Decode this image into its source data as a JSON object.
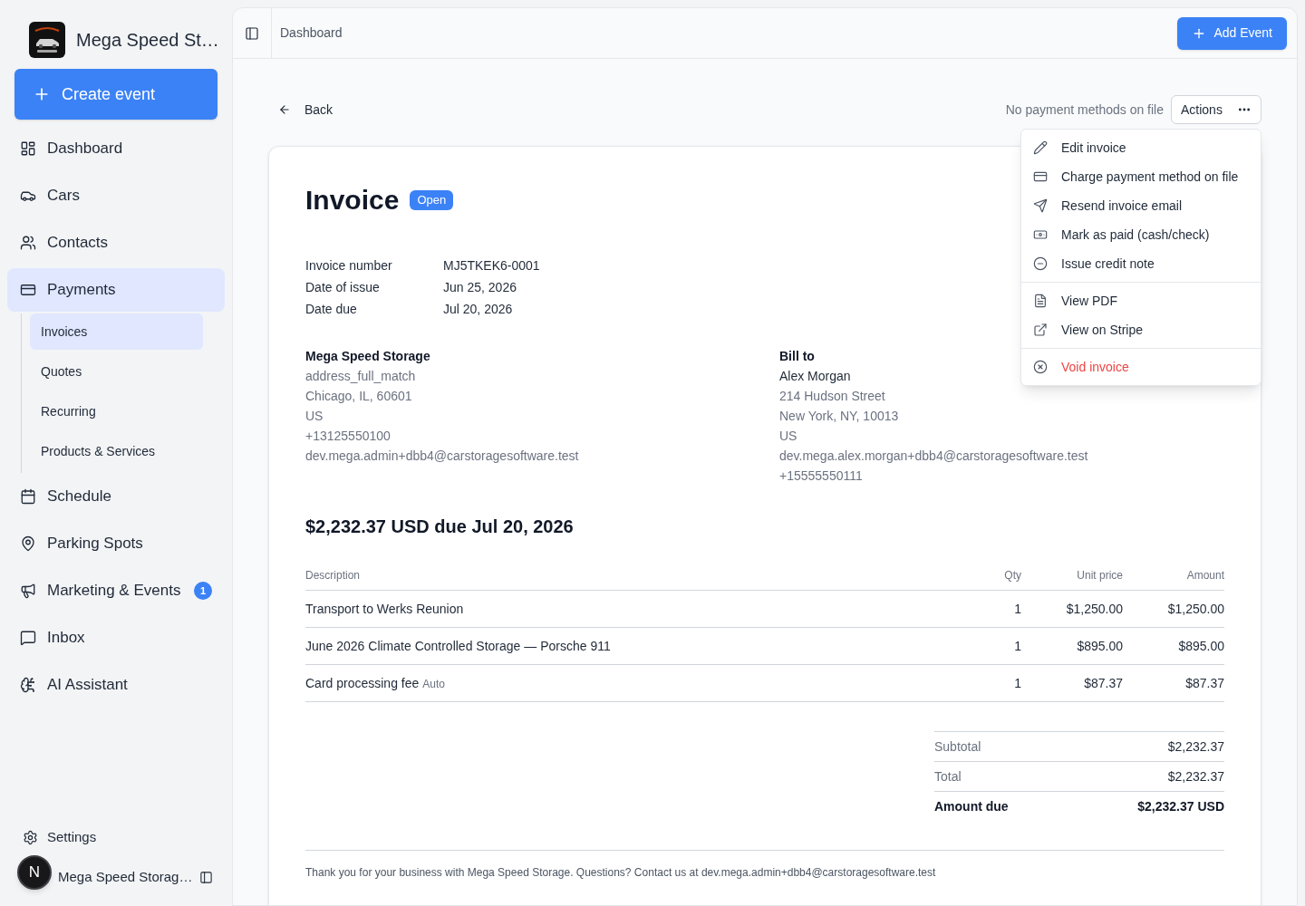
{
  "sidebar": {
    "brand": {
      "name": "Mega Speed St…"
    },
    "create_button": {
      "label": "Create event"
    },
    "nav": [
      {
        "label": "Dashboard",
        "selected": false
      },
      {
        "label": "Cars",
        "selected": false
      },
      {
        "label": "Contacts",
        "selected": false
      },
      {
        "label": "Payments",
        "selected": true,
        "children": [
          {
            "label": "Invoices",
            "selected": true
          },
          {
            "label": "Quotes",
            "selected": false
          },
          {
            "label": "Recurring",
            "selected": false
          },
          {
            "label": "Products & Services",
            "selected": false
          }
        ]
      },
      {
        "label": "Schedule",
        "selected": false
      },
      {
        "label": "Parking Spots",
        "selected": false
      },
      {
        "label": "Marketing & Events",
        "selected": false,
        "badge": "1"
      },
      {
        "label": "Inbox",
        "selected": false
      },
      {
        "label": "AI Assistant",
        "selected": false
      }
    ],
    "settings": {
      "label": "Settings"
    },
    "account": {
      "name": "Mega Speed Storag…"
    },
    "dev_indicator": {
      "label": "N"
    }
  },
  "header": {
    "breadcrumb": "Dashboard",
    "add_button": {
      "label": "Add Event"
    }
  },
  "toolbar": {
    "back": "Back",
    "payment_note": "No payment methods on file",
    "actions_button": {
      "label": "Actions"
    }
  },
  "invoice": {
    "title": "Invoice",
    "status": "Open",
    "details": [
      {
        "label": "Invoice number",
        "value": "MJ5TKEK6-0001"
      },
      {
        "label": "Date of issue",
        "value": "Jun 25, 2026"
      },
      {
        "label": "Date due",
        "value": "Jul 20, 2026"
      }
    ],
    "from": {
      "name": "Mega Speed Storage",
      "lines": [
        "address_full_match",
        "Chicago, IL, 60601",
        "US",
        "+13125550100",
        "dev.mega.admin+dbb4@carstoragesoftware.test"
      ]
    },
    "bill_to": {
      "heading": "Bill to",
      "name": "Alex Morgan",
      "lines": [
        "214 Hudson Street",
        "New York, NY, 10013",
        "US",
        "dev.mega.alex.morgan+dbb4@carstoragesoftware.test",
        "+15555550111"
      ]
    },
    "amount_due_heading": "$2,232.37 USD due Jul 20, 2026",
    "table": {
      "columns": [
        "Description",
        "Qty",
        "Unit price",
        "Amount"
      ],
      "rows": [
        {
          "description": "Transport to Werks Reunion",
          "qty": "1",
          "unit_price": "$1,250.00",
          "amount": "$1,250.00"
        },
        {
          "description": "June 2026 Climate Controlled Storage — Porsche 911",
          "qty": "1",
          "unit_price": "$895.00",
          "amount": "$895.00"
        },
        {
          "description": "Card processing fee",
          "note": "Auto",
          "qty": "1",
          "unit_price": "$87.37",
          "amount": "$87.37"
        }
      ]
    },
    "totals": [
      {
        "label": "Subtotal",
        "value": "$2,232.37",
        "emphasized": false
      },
      {
        "label": "Total",
        "value": "$2,232.37",
        "emphasized": false
      },
      {
        "label": "Amount due",
        "value": "$2,232.37 USD",
        "emphasized": true
      }
    ],
    "footer": "Thank you for your business with Mega Speed Storage. Questions? Contact us at dev.mega.admin+dbb4@carstoragesoftware.test"
  },
  "actions_menu": {
    "groups": [
      {
        "items": [
          {
            "label": "Edit invoice",
            "danger": false
          },
          {
            "label": "Charge payment method on file",
            "danger": false
          },
          {
            "label": "Resend invoice email",
            "danger": false
          },
          {
            "label": "Mark as paid (cash/check)",
            "danger": false
          },
          {
            "label": "Issue credit note",
            "danger": false
          }
        ]
      },
      {
        "items": [
          {
            "label": "View PDF",
            "danger": false
          },
          {
            "label": "View on Stripe",
            "danger": false
          }
        ]
      },
      {
        "items": [
          {
            "label": "Void invoice",
            "danger": true
          }
        ]
      }
    ]
  }
}
